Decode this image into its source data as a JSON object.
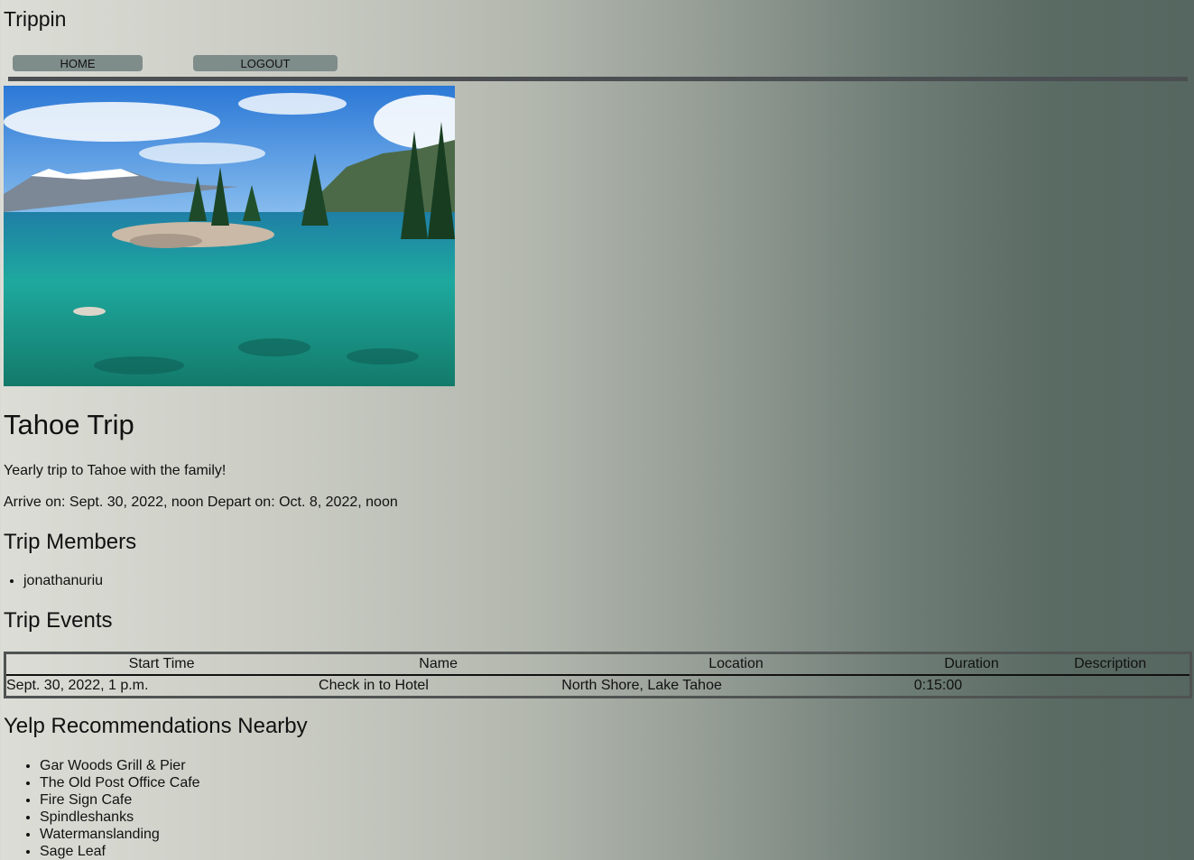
{
  "header": {
    "brand": "Trippin"
  },
  "nav": {
    "home_label": "HOME",
    "logout_label": "LOGOUT"
  },
  "trip": {
    "title": "Tahoe Trip",
    "description": "Yearly trip to Tahoe with the family!",
    "dates": "Arrive on: Sept. 30, 2022, noon Depart on: Oct. 8, 2022, noon"
  },
  "members": {
    "heading": "Trip Members",
    "items": [
      "jonathanuriu"
    ]
  },
  "events": {
    "heading": "Trip Events",
    "columns": [
      "Start Time",
      "Name",
      "Location",
      "Duration",
      "Description"
    ],
    "rows": [
      [
        "Sept. 30, 2022, 1 p.m.",
        "Check in to Hotel",
        "North Shore, Lake Tahoe",
        "0:15:00",
        ""
      ]
    ]
  },
  "yelp": {
    "heading": "Yelp Recommendations Nearby",
    "items": [
      "Gar Woods Grill & Pier",
      "The Old Post Office Cafe",
      "Fire Sign Cafe",
      "Spindleshanks",
      "Watermanslanding",
      "Sage Leaf"
    ]
  },
  "colors": {
    "nav_button": "#7e8c8a",
    "nav_rule": "#4b4f52"
  },
  "icons": {
    "hero_image": "lake-tahoe-photo"
  }
}
